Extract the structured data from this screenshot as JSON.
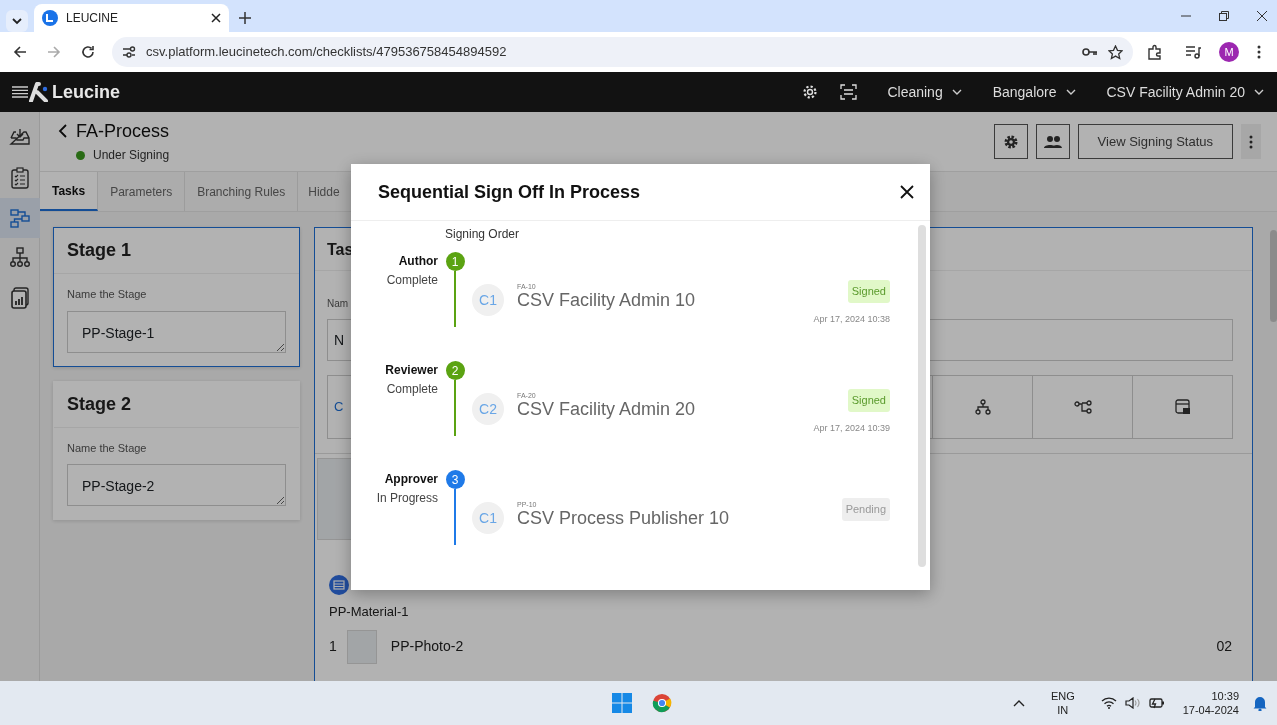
{
  "browser": {
    "tab_title": "LEUCINE",
    "url": "csv.platform.leucinetech.com/checklists/479536758454894592",
    "profile_initial": "M"
  },
  "navbar": {
    "brand": "Leucine",
    "menus": [
      {
        "label": "Cleaning"
      },
      {
        "label": "Bangalore"
      },
      {
        "label": "CSV Facility Admin 20"
      }
    ]
  },
  "sidebar": {
    "items": [
      {
        "kind": "inbox",
        "selected": false
      },
      {
        "kind": "checklist",
        "selected": false
      },
      {
        "kind": "flow",
        "selected": true
      },
      {
        "kind": "hierarchy",
        "selected": false
      },
      {
        "kind": "report",
        "selected": false
      }
    ]
  },
  "header": {
    "title": "FA-Process",
    "status": "Under Signing",
    "action_button": "View Signing Status"
  },
  "tabs": [
    {
      "label": "Tasks",
      "selected": true
    },
    {
      "label": "Parameters",
      "selected": false
    },
    {
      "label": "Branching Rules",
      "selected": false
    },
    {
      "label": "Hidde",
      "selected": false
    }
  ],
  "stages": [
    {
      "title": "Stage 1",
      "field_label": "Name the Stage",
      "value": "PP-Stage-1",
      "selected": true
    },
    {
      "title": "Stage 2",
      "field_label": "Name the Stage",
      "value": "PP-Stage-2",
      "selected": false
    }
  ],
  "task_card": {
    "title": "Tas",
    "field_label": "Nam",
    "value": "N",
    "link": "C",
    "material": "PP-Material-1",
    "media": [
      {
        "index": "1",
        "name": "PP-Photo-2",
        "count": "02"
      }
    ]
  },
  "modal": {
    "title": "Sequential Sign Off In Process",
    "subtitle": "Signing Order",
    "steps": [
      {
        "number": "1",
        "role": "Author",
        "status": "Complete",
        "color": "#5ba312",
        "signer": {
          "initials": "C1",
          "code": "FA-10",
          "name": "CSV Facility Admin 10",
          "badge": {
            "label": "Signed",
            "kind": "signed"
          },
          "date": "Apr 17, 2024 10:38"
        }
      },
      {
        "number": "2",
        "role": "Reviewer",
        "status": "Complete",
        "color": "#5ba312",
        "signer": {
          "initials": "C2",
          "code": "FA-20",
          "name": "CSV Facility Admin 20",
          "badge": {
            "label": "Signed",
            "kind": "signed"
          },
          "date": "Apr 17, 2024 10:39"
        }
      },
      {
        "number": "3",
        "role": "Approver",
        "status": "In Progress",
        "color": "#1f7ae8",
        "signer": {
          "initials": "C1",
          "code": "PP-10",
          "name": "CSV Process Publisher 10",
          "badge": {
            "label": "Pending",
            "kind": "pending"
          }
        }
      }
    ]
  },
  "taskbar": {
    "language": "ENG",
    "region": "IN",
    "time": "10:39",
    "date": "17-04-2024"
  }
}
